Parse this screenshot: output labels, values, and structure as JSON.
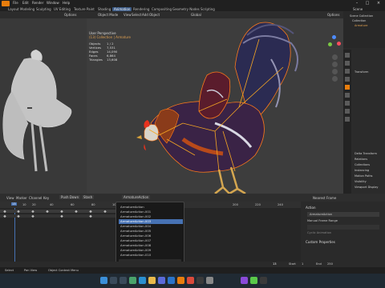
{
  "menu": {
    "tabs": [
      "Layout",
      "Modeling",
      "Sculpting",
      "UV Editing",
      "Texture Paint",
      "Shading",
      "Animation",
      "Rendering",
      "Compositing",
      "Geometry Nodes",
      "Scripting"
    ],
    "active_tab": "Animation",
    "scene_label": "Scene"
  },
  "viewport": {
    "mode": "Object Mode",
    "menus": [
      "View",
      "Select",
      "Add",
      "Object"
    ],
    "transform": "Global",
    "options_label": "Options",
    "perspective_label": "User Perspective",
    "collection_label": "(13) Collection | Armature",
    "stats": [
      {
        "label": "Objects",
        "value": "1 / 2"
      },
      {
        "label": "Vertices",
        "value": "7,531"
      },
      {
        "label": "Edges",
        "value": "14,090"
      },
      {
        "label": "Faces",
        "value": "6,864"
      },
      {
        "label": "Triangles",
        "value": "13,608"
      }
    ]
  },
  "left_viewport": {
    "options_label": "Options"
  },
  "timeline": {
    "menus": [
      "View",
      "Marker",
      "Channel",
      "Key"
    ],
    "push_down": "Push Down",
    "stash": "Stash",
    "action_name": "ArmatureAction",
    "nearest_frame": "Nearest Frame",
    "ruler_ticks": [
      "10",
      "20",
      "40",
      "60",
      "80",
      "100",
      "200",
      "220",
      "240"
    ],
    "current_frame": "13",
    "start_label": "Start",
    "start_value": "1",
    "end_label": "End",
    "end_value": "250",
    "frame_value": "13"
  },
  "dropdown": {
    "items": [
      "ArmatureAction",
      "ArmatureAction.001",
      "ArmatureAction.002",
      "ArmatureAction.003",
      "ArmatureAction.004",
      "ArmatureAction.005",
      "ArmatureAction.006",
      "ArmatureAction.007",
      "ArmatureAction.008",
      "ArmatureAction.009",
      "ArmatureAction.010",
      "ArmatureAction.011"
    ],
    "selected_index": 3
  },
  "action_panel": {
    "section": "Action",
    "action_name": "ArmatureAction",
    "manual_frame_range": "Manual Frame Range",
    "cyclic": "Cyclic Animation",
    "custom_properties": "Custom Properties"
  },
  "right_panel": {
    "items": [
      "Scene Collection",
      "Collection",
      "Armature",
      "Transform",
      "Delta Transform",
      "Relations",
      "Collections",
      "Instancing",
      "Motion Paths",
      "Visibility",
      "Viewport Display",
      "Line Art",
      "Custom Properties"
    ]
  },
  "status_bar": {
    "left": "Select",
    "middle": "Pan View",
    "right": "Object Context Menu"
  },
  "taskbar": {
    "time": "",
    "icons": [
      "start-icon",
      "search-icon",
      "task-view-icon",
      "widgets-icon",
      "edge-icon",
      "explorer-icon",
      "store-icon",
      "mail-icon",
      "blender-icon",
      "chrome-icon",
      "terminal-icon",
      "settings-icon"
    ]
  },
  "colors": {
    "accent": "#4772b3",
    "armature": "#f5a623",
    "selection_outline": "#ff7a1a",
    "playhead": "#4772b3"
  }
}
